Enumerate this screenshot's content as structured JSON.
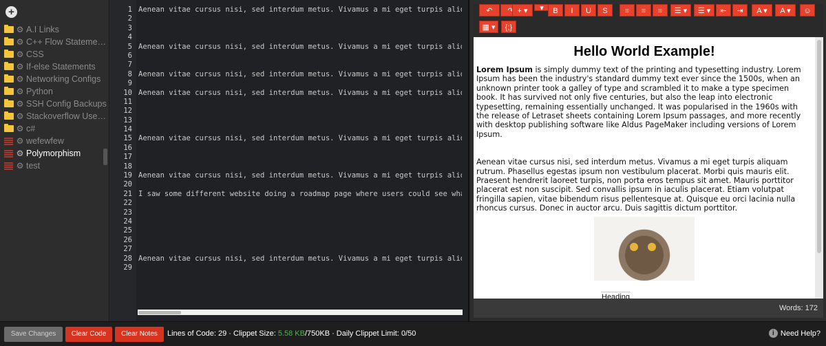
{
  "sidebar": {
    "add_icon": "plus-circle-icon",
    "items": [
      {
        "label": "A.I Links",
        "type": "folder"
      },
      {
        "label": "C++ Flow Stateme…",
        "type": "folder"
      },
      {
        "label": "CSS",
        "type": "folder"
      },
      {
        "label": "If-else Statements",
        "type": "folder"
      },
      {
        "label": "Networking Configs",
        "type": "folder"
      },
      {
        "label": "Python",
        "type": "folder"
      },
      {
        "label": "SSH Config Backups",
        "type": "folder"
      },
      {
        "label": "Stackoverflow Use…",
        "type": "folder"
      },
      {
        "label": "c#",
        "type": "folder"
      },
      {
        "label": "wefewfew",
        "type": "file"
      },
      {
        "label": "Polymorphism",
        "type": "file",
        "active": true
      },
      {
        "label": "test",
        "type": "file"
      }
    ]
  },
  "code": {
    "lines": [
      {
        "n": "1",
        "text": "Aenean vitae cursus nisi, sed interdum metus. Vivamus a mi eget turpis aliquam"
      },
      {
        "n": "2",
        "text": ""
      },
      {
        "n": "3",
        "text": ""
      },
      {
        "n": "4",
        "text": ""
      },
      {
        "n": "5",
        "text": "Aenean vitae cursus nisi, sed interdum metus. Vivamus a mi eget turpis aliquam"
      },
      {
        "n": "6",
        "text": ""
      },
      {
        "n": "7",
        "text": ""
      },
      {
        "n": "8",
        "text": "Aenean vitae cursus nisi, sed interdum metus. Vivamus a mi eget turpis aliquam"
      },
      {
        "n": "9",
        "text": ""
      },
      {
        "n": "10",
        "text": "Aenean vitae cursus nisi, sed interdum metus. Vivamus a mi eget turpis aliquam"
      },
      {
        "n": "11",
        "text": ""
      },
      {
        "n": "12",
        "text": ""
      },
      {
        "n": "13",
        "text": ""
      },
      {
        "n": "14",
        "text": ""
      },
      {
        "n": "15",
        "text": "Aenean vitae cursus nisi, sed interdum metus. Vivamus a mi eget turpis aliquam"
      },
      {
        "n": "16",
        "text": ""
      },
      {
        "n": "17",
        "text": ""
      },
      {
        "n": "18",
        "text": ""
      },
      {
        "n": "19",
        "text": "Aenean vitae cursus nisi, sed interdum metus. Vivamus a mi eget turpis aliquam"
      },
      {
        "n": "20",
        "text": ""
      },
      {
        "n": "21",
        "text": "I saw some different website doing a roadmap page where users could see what th"
      },
      {
        "n": "22",
        "text": ""
      },
      {
        "n": "23",
        "text": ""
      },
      {
        "n": "24",
        "text": ""
      },
      {
        "n": "25",
        "text": ""
      },
      {
        "n": "26",
        "text": ""
      },
      {
        "n": "27",
        "text": ""
      },
      {
        "n": "28",
        "text": "Aenean vitae cursus nisi, sed interdum metus. Vivamus a mi eget turpis aliquam"
      },
      {
        "n": "29",
        "text": ""
      }
    ]
  },
  "toolbar": {
    "buttons": [
      {
        "icon": "undo-icon",
        "glyph": "↶"
      },
      {
        "icon": "redo-icon",
        "glyph": "↷"
      },
      {
        "icon": "insert-icon",
        "glyph": "+ ▾"
      },
      {
        "icon": "dropdown-icon",
        "glyph": "▾"
      },
      {
        "icon": "bold-icon",
        "glyph": "B"
      },
      {
        "icon": "italic-icon",
        "glyph": "I"
      },
      {
        "icon": "underline-icon",
        "glyph": "U"
      },
      {
        "icon": "strikethrough-icon",
        "glyph": "S"
      },
      {
        "icon": "align-left-icon",
        "glyph": "≡"
      },
      {
        "icon": "align-center-icon",
        "glyph": "≡"
      },
      {
        "icon": "align-right-icon",
        "glyph": "≡"
      },
      {
        "icon": "bullet-list-icon",
        "glyph": "☰ ▾"
      },
      {
        "icon": "number-list-icon",
        "glyph": "☰ ▾"
      },
      {
        "icon": "outdent-icon",
        "glyph": "⇤"
      },
      {
        "icon": "indent-icon",
        "glyph": "⇥"
      },
      {
        "icon": "font-color-icon",
        "glyph": "A ▾"
      },
      {
        "icon": "highlight-icon",
        "glyph": "A ▾"
      },
      {
        "icon": "emoji-icon",
        "glyph": "☺"
      },
      {
        "icon": "table-icon",
        "glyph": "▦ ▾"
      },
      {
        "icon": "code-icon",
        "glyph": "{;}"
      }
    ]
  },
  "notes": {
    "title": "Hello World Example!",
    "p1_bold": "Lorem Ipsum",
    "p1_rest": " is simply dummy text of the printing and typesetting industry. Lorem Ipsum has been the industry's standard dummy text ever since the 1500s, when an unknown printer took a galley of type and scrambled it to make a type specimen book. It has survived not only five centuries, but also the leap into electronic typesetting, remaining essentially unchanged. It was popularised in the 1960s with the release of Letraset sheets containing Lorem Ipsum passages, and more recently with desktop publishing software like Aldus PageMaker including versions of Lorem Ipsum.",
    "p2": "Aenean vitae cursus nisi, sed interdum metus. Vivamus a mi eget turpis aliquam rutrum. Phasellus egestas ipsum non vestibulum placerat. Morbi quis mauris elit. Praesent hendrerit laoreet turpis, non porta eros tempus sit amet. Mauris porttitor placerat est non suscipit. Sed convallis ipsum in iaculis placerat. Etiam volutpat fringilla sapien, vitae bibendum risus pellentesque at. Quisque eu orci lacinia nulla rhoncus cursus. Donec in auctor arcu. Duis sagittis dictum porttitor.",
    "heading_fragment": "Heading",
    "word_count": "Words: 172"
  },
  "bottom": {
    "save_label": "Save Changes",
    "clear_code_label": "Clear Code",
    "clear_notes_label": "Clear Notes",
    "lines_text": "Lines of Code: 29 · Clippet Size: ",
    "size_used": "5.58 KB",
    "size_rest": "/750KB · Daily Clippet Limit: 0/50",
    "help_label": "Need Help?"
  },
  "colors": {
    "accent": "#e8412c",
    "size_used": "#3fbf3f"
  }
}
